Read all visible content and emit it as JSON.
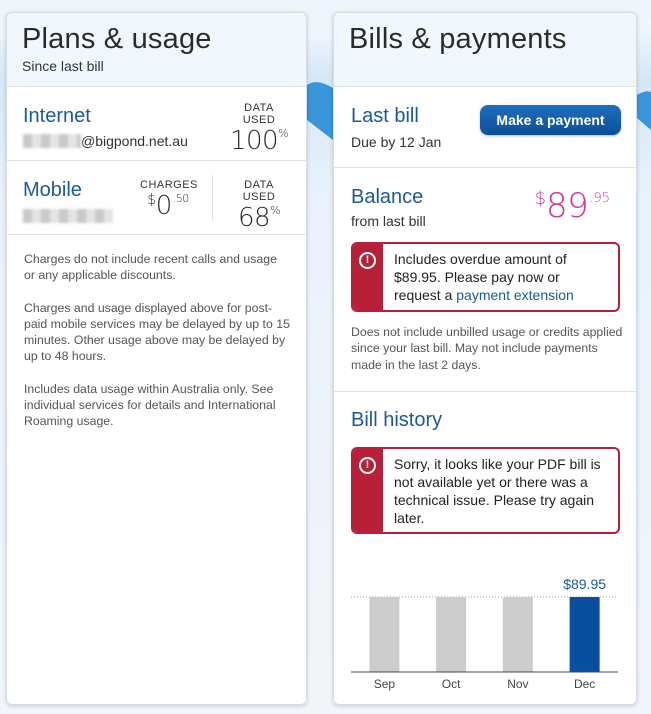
{
  "plans": {
    "title": "Plans & usage",
    "subtitle": "Since last bill",
    "internet": {
      "name": "Internet",
      "account_suffix": "@bigpond.net.au",
      "data_used_label": "DATA USED",
      "data_used_value": "100",
      "data_used_unit": "%"
    },
    "mobile": {
      "name": "Mobile",
      "charges_label": "CHARGES",
      "charges_currency": "$",
      "charges_dollars": "0",
      "charges_cents": ".50",
      "data_used_label": "DATA USED",
      "data_used_value": "68",
      "data_used_unit": "%"
    },
    "notes": [
      "Charges do not include recent calls and usage or any applicable discounts.",
      "Charges and usage displayed above for post-paid mobile services may be delayed by up to 15 minutes. Other usage above may be delayed by up to 48 hours.",
      "Includes data usage within Australia only. See individual services for details and International Roaming usage."
    ]
  },
  "bills": {
    "title": "Bills & payments",
    "last_bill": {
      "title": "Last bill",
      "due": "Due by 12 Jan",
      "pay_button": "Make a payment"
    },
    "balance": {
      "title": "Balance",
      "subtitle": "from last bill",
      "currency": "$",
      "dollars": "89",
      "cents": ".95",
      "color": "#d6318f"
    },
    "overdue_alert": {
      "text_before": "Includes overdue amount of $89.95. Please pay now or request a ",
      "link": "payment extension"
    },
    "note": "Does not include unbilled usage or credits applied since your last bill. May not include payments made in the last 2 days.",
    "history": {
      "title": "Bill history",
      "alert": "Sorry, it looks like your PDF bill is not available yet or there was a technical issue. Please try again later."
    }
  },
  "chart_data": {
    "type": "bar",
    "categories": [
      "Sep",
      "Oct",
      "Nov",
      "Dec"
    ],
    "values": [
      89.95,
      89.95,
      89.95,
      89.95
    ],
    "highlight_label": "$89.95",
    "highlight_index": 3,
    "colors": {
      "default": "#cccccc",
      "highlight": "#0a4ea0",
      "label": "#1a5a9c"
    },
    "ylim": [
      0,
      89.95
    ],
    "grid": false
  },
  "colors": {
    "brand_blue": "#1a5a9c",
    "alert_red": "#b81f38",
    "magenta": "#d6318f"
  }
}
